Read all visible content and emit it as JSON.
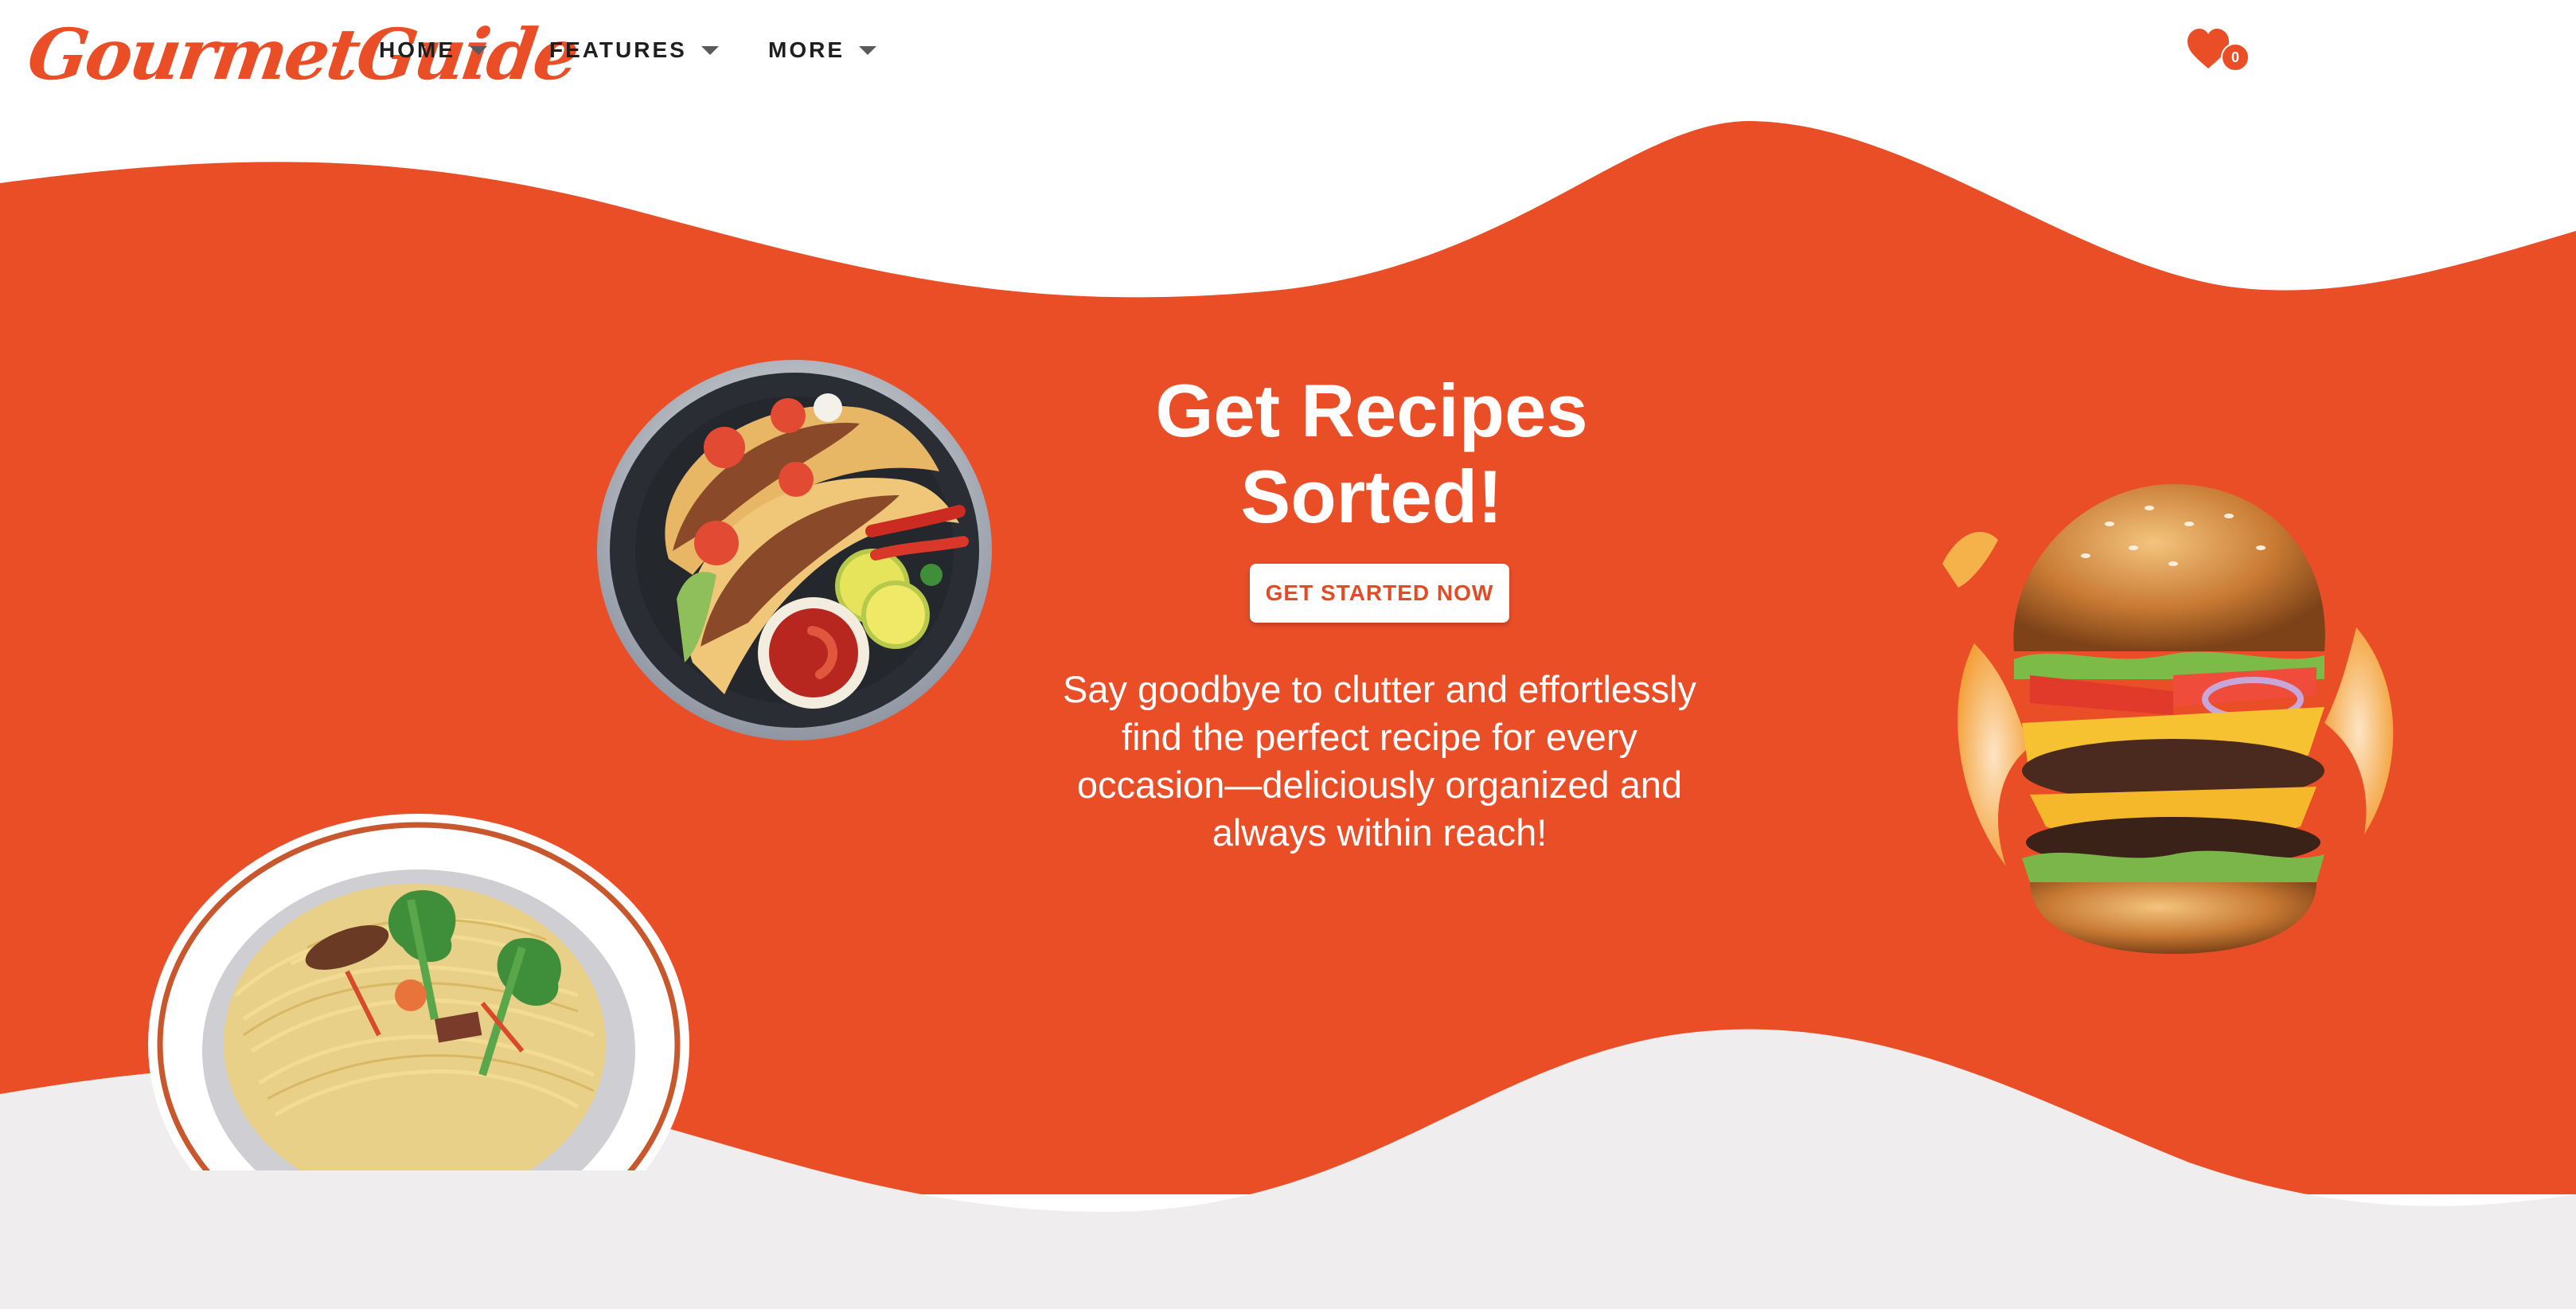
{
  "header": {
    "logo_text": "GourmetGuide",
    "nav": [
      {
        "label": "HOME"
      },
      {
        "label": "FEATURES"
      },
      {
        "label": "MORE"
      }
    ],
    "favorites_count": "0"
  },
  "hero": {
    "title": "Get Recipes Sorted!",
    "cta_label": "GET STARTED NOW",
    "subtitle": "Say goodbye to clutter and effortlessly find the perfect recipe for every occasion—deliciously organized and always within reach!"
  },
  "images": {
    "tacos": "tacos-plate-illustration",
    "noodles": "noodles-plate-illustration",
    "burger": "burger-photo"
  },
  "colors": {
    "brand": "#ea4e26",
    "wave": "#e94e27",
    "lower_band": "#efedee",
    "text_dark": "#1f1f1f"
  }
}
